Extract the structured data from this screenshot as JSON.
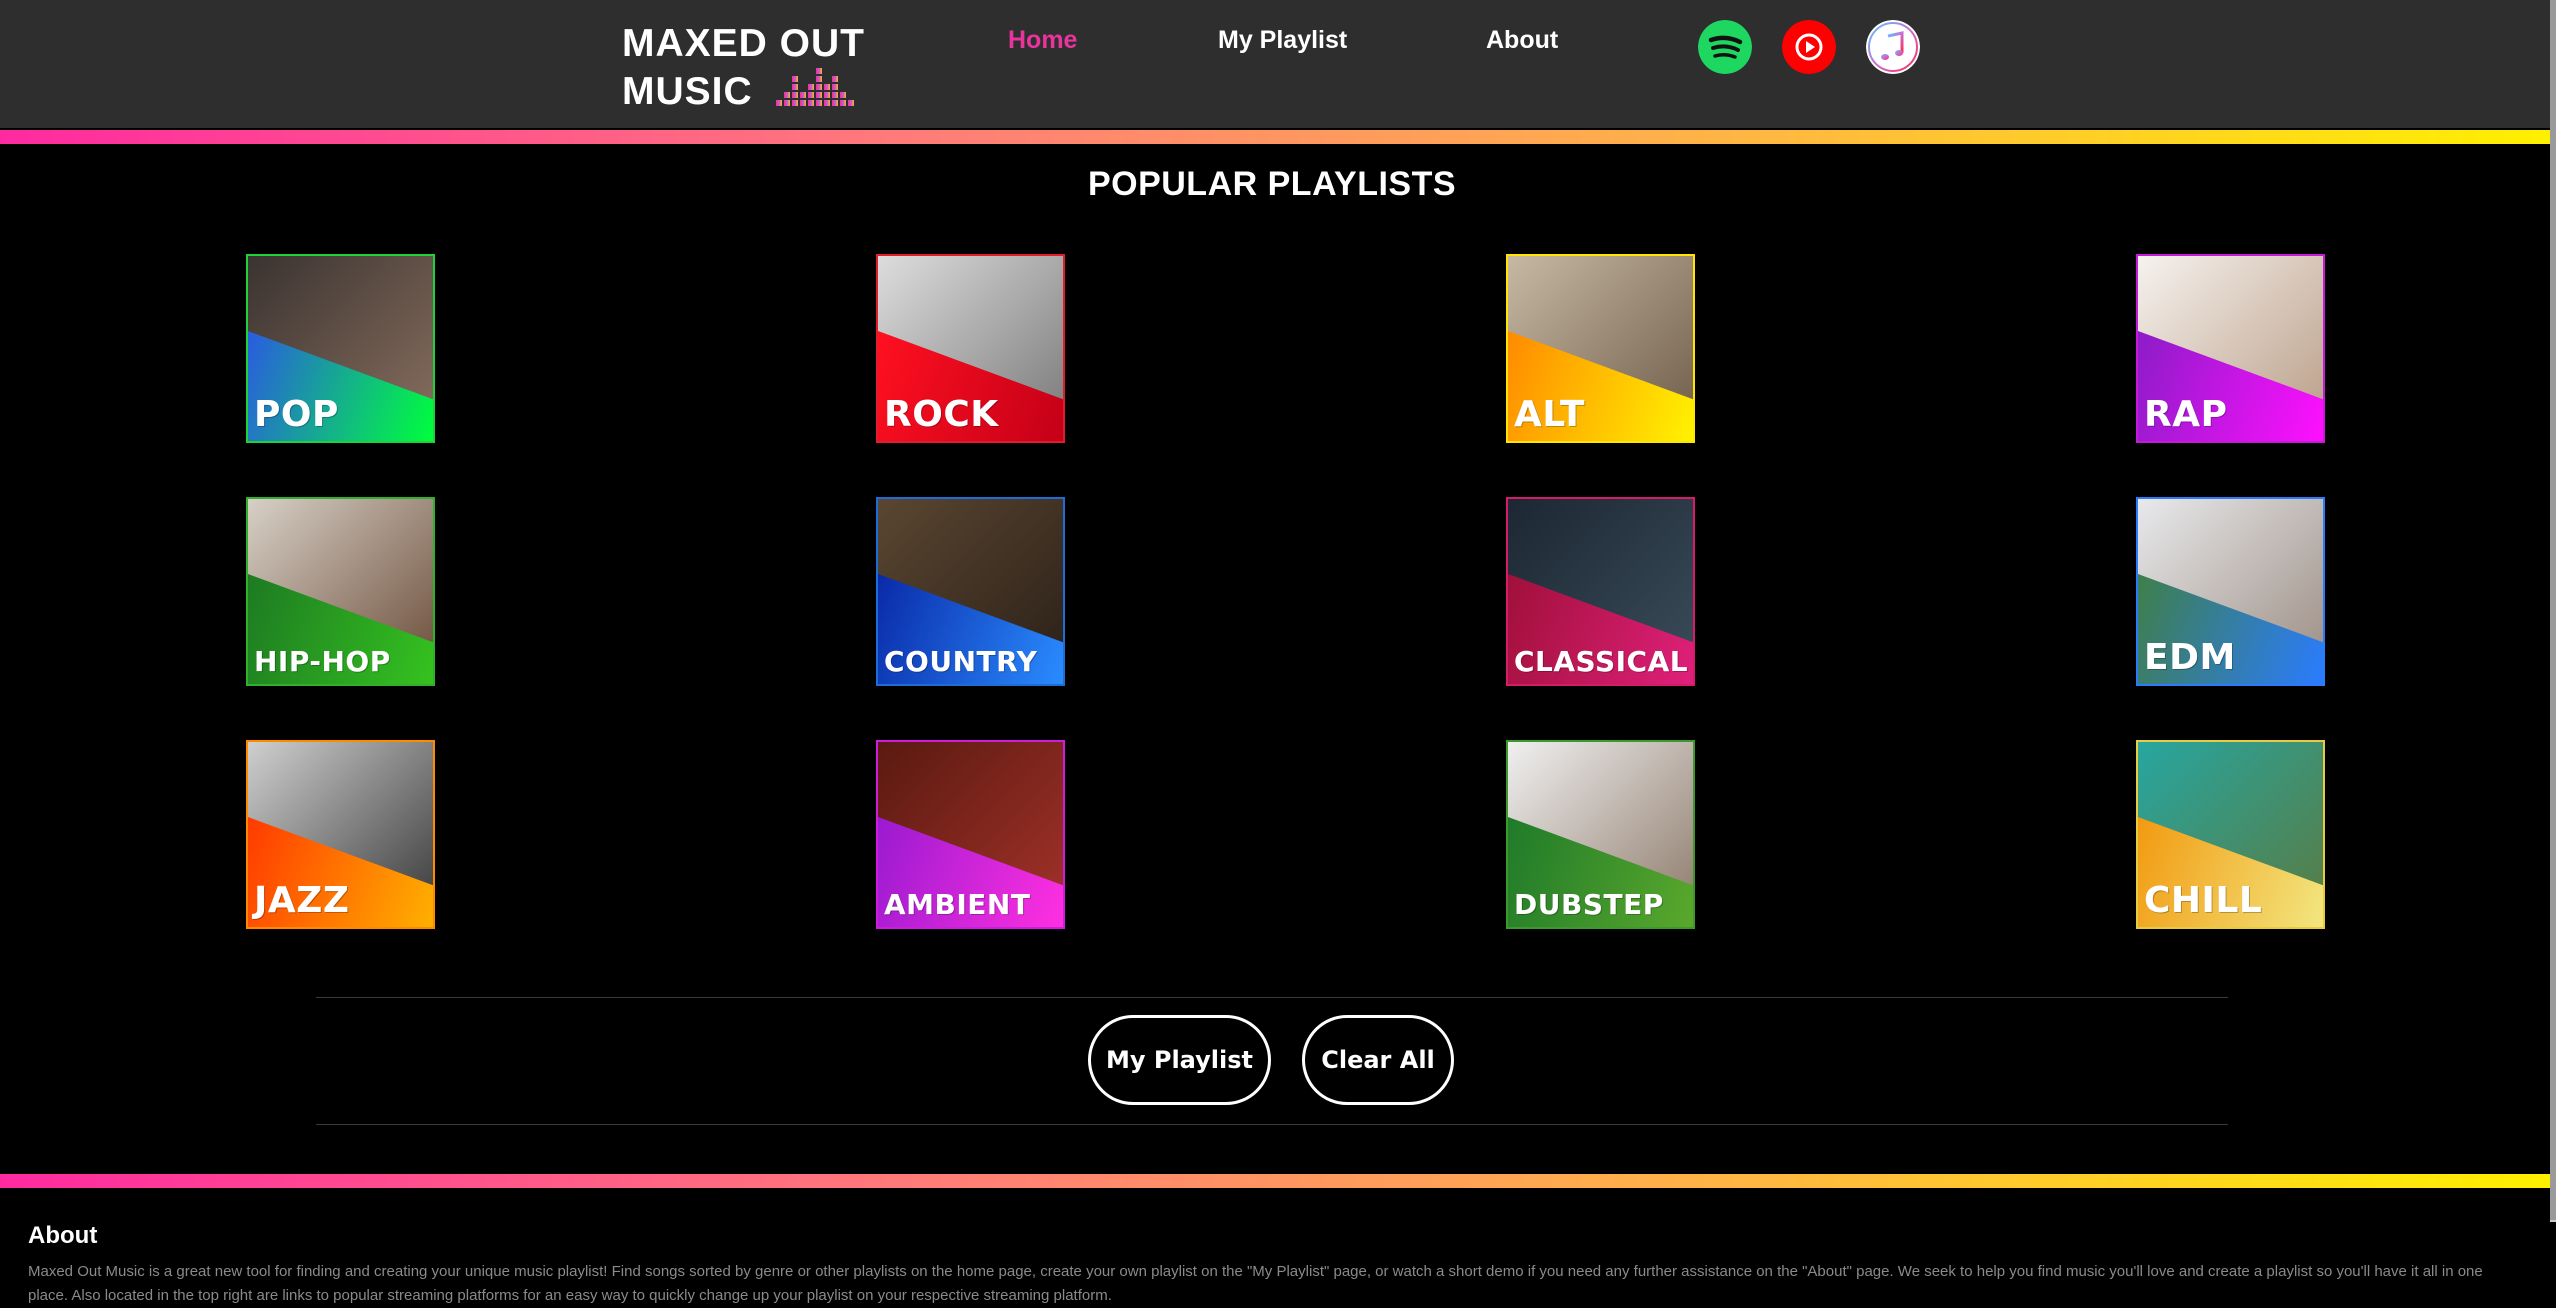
{
  "header": {
    "logo_line1": "MAXED OUT",
    "logo_line2": "MUSIC",
    "nav": [
      {
        "label": "Home",
        "active": true
      },
      {
        "label": "My Playlist",
        "active": false
      },
      {
        "label": "About",
        "active": false
      }
    ],
    "streaming_icons": [
      "spotify-icon",
      "youtube-icon",
      "apple-music-icon"
    ]
  },
  "main": {
    "title": "POPULAR PLAYLISTS",
    "playlists": [
      {
        "label": "POP",
        "colors": [
          "#2a5be0",
          "#00ff3c"
        ],
        "border": "#1fd23a"
      },
      {
        "label": "ROCK",
        "colors": [
          "#ff1020",
          "#c40018"
        ],
        "border": "#e21d2b"
      },
      {
        "label": "ALT",
        "colors": [
          "#ff8a00",
          "#fff200"
        ],
        "border": "#ffe600"
      },
      {
        "label": "RAP",
        "colors": [
          "#8c1cc8",
          "#ff10ff"
        ],
        "border": "#c51ad7"
      },
      {
        "label": "HIP-HOP",
        "colors": [
          "#1d7a22",
          "#35c21f"
        ],
        "border": "#2db22a"
      },
      {
        "label": "COUNTRY",
        "colors": [
          "#0a2aa8",
          "#2a8cff"
        ],
        "border": "#1b6ed8"
      },
      {
        "label": "CLASSICAL",
        "colors": [
          "#a0103a",
          "#e0207a"
        ],
        "border": "#d81a6d"
      },
      {
        "label": "EDM",
        "colors": [
          "#3f7f4a",
          "#2a7cff"
        ],
        "border": "#2a7cff"
      },
      {
        "label": "JAZZ",
        "colors": [
          "#ff3a00",
          "#ffb000"
        ],
        "border": "#ff8a00"
      },
      {
        "label": "AMBIENT",
        "colors": [
          "#9a1ad0",
          "#ff30e0"
        ],
        "border": "#d01ae0"
      },
      {
        "label": "DUBSTEP",
        "colors": [
          "#1f7a2a",
          "#5aa82c"
        ],
        "border": "#3a9a2a"
      },
      {
        "label": "CHILL",
        "colors": [
          "#f29a10",
          "#f2e680"
        ],
        "border": "#e8cc40"
      }
    ],
    "buttons": {
      "my_playlist": "My Playlist",
      "clear_all": "Clear All"
    }
  },
  "footer": {
    "title": "About",
    "text": "Maxed Out Music is a great new tool for finding and creating your unique music playlist! Find songs sorted by genre or other playlists on the home page, create your own playlist on the \"My Playlist\" page, or watch a short demo if you need any further assistance on the \"About\" page. We seek to help you find music you'll love and create a playlist so you'll have it all in one place. Also located in the top right are links to popular streaming platforms for an easy way to quickly change up your playlist on your respective streaming platform."
  }
}
